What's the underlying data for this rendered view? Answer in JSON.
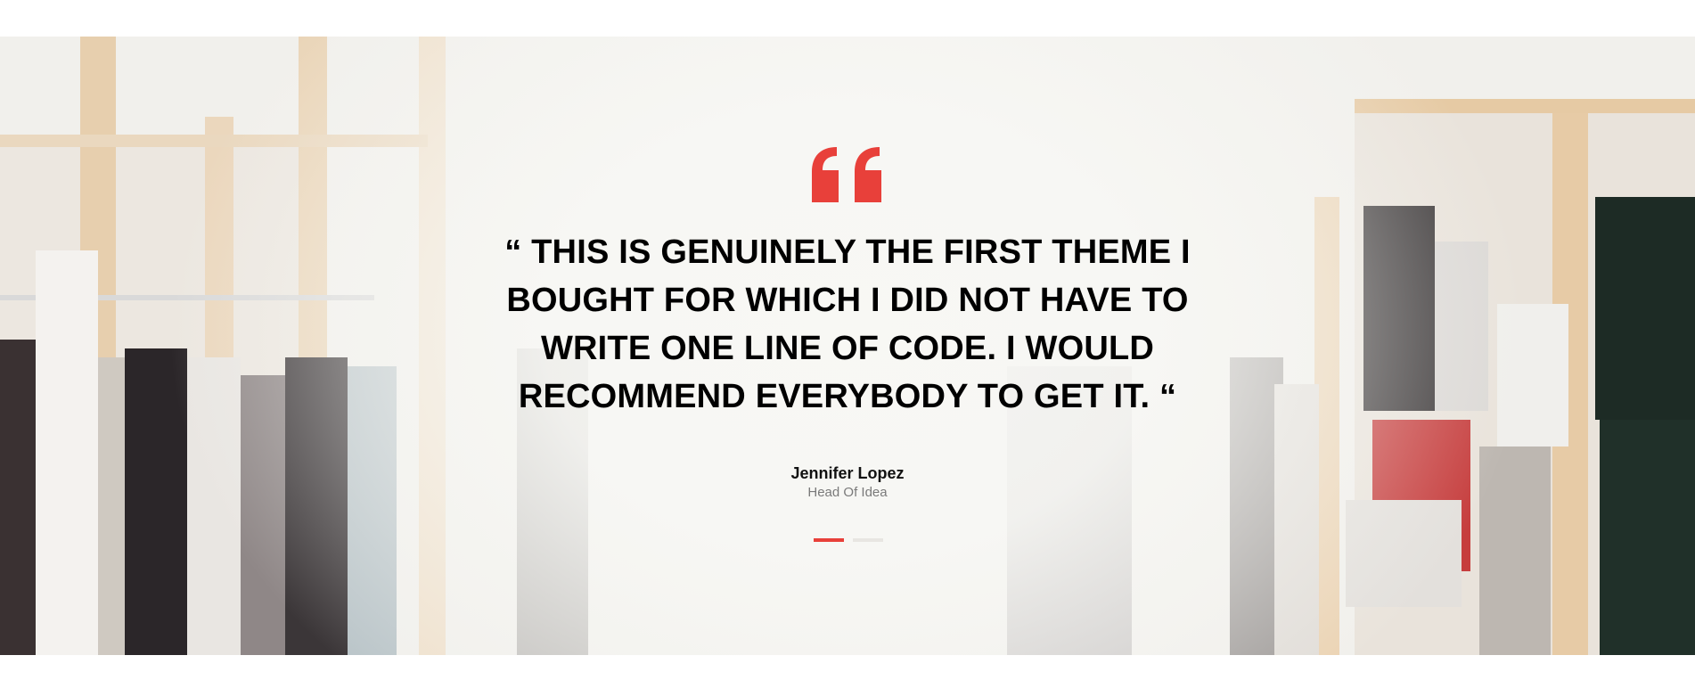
{
  "testimonial": {
    "quote": "“ THIS IS GENUINELY THE FIRST THEME I BOUGHT FOR WHICH I DID NOT HAVE TO WRITE ONE LINE OF CODE. I WOULD RECOMMEND EVERYBODY TO GET IT. “",
    "author": "Jennifer Lopez",
    "role": "Head Of Idea",
    "active_slide": 1,
    "slide_count": 2
  },
  "colors": {
    "accent": "#e8403a",
    "text": "#000000",
    "muted": "#7a7a7a",
    "inactive_dot": "#e8e6e2"
  },
  "icons": {
    "quote": "quote-mark-icon"
  }
}
